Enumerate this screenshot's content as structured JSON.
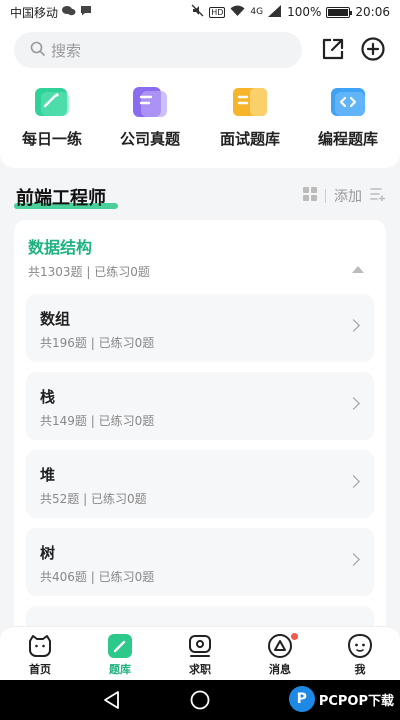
{
  "status": {
    "carrier": "中国移动",
    "battery": "100%",
    "battery_level": 1.0,
    "network": "4G",
    "time": "20:06"
  },
  "search": {
    "placeholder": "搜索"
  },
  "quick_entries": [
    {
      "label": "每日一练",
      "color": "#2fd39a"
    },
    {
      "label": "公司真题",
      "color": "#8a6cf0"
    },
    {
      "label": "面试题库",
      "color": "#f7b52c"
    },
    {
      "label": "编程题库",
      "color": "#3ea2f5"
    }
  ],
  "track": {
    "title": "前端工程师",
    "add_label": "添加"
  },
  "category": {
    "title": "数据结构",
    "stats": "共1303题 | 已练习0题",
    "items": [
      {
        "name": "数组",
        "stats": "共196题 | 已练习0题"
      },
      {
        "name": "栈",
        "stats": "共149题 | 已练习0题"
      },
      {
        "name": "堆",
        "stats": "共52题 | 已练习0题"
      },
      {
        "name": "树",
        "stats": "共406题 | 已练习0题"
      }
    ]
  },
  "tabs": [
    {
      "label": "首页"
    },
    {
      "label": "题库"
    },
    {
      "label": "求职"
    },
    {
      "label": "消息"
    },
    {
      "label": "我"
    }
  ],
  "watermark": {
    "text": "PCPOP下载"
  },
  "colors": {
    "accent": "#1fb381",
    "badge": "#f05a4c"
  }
}
